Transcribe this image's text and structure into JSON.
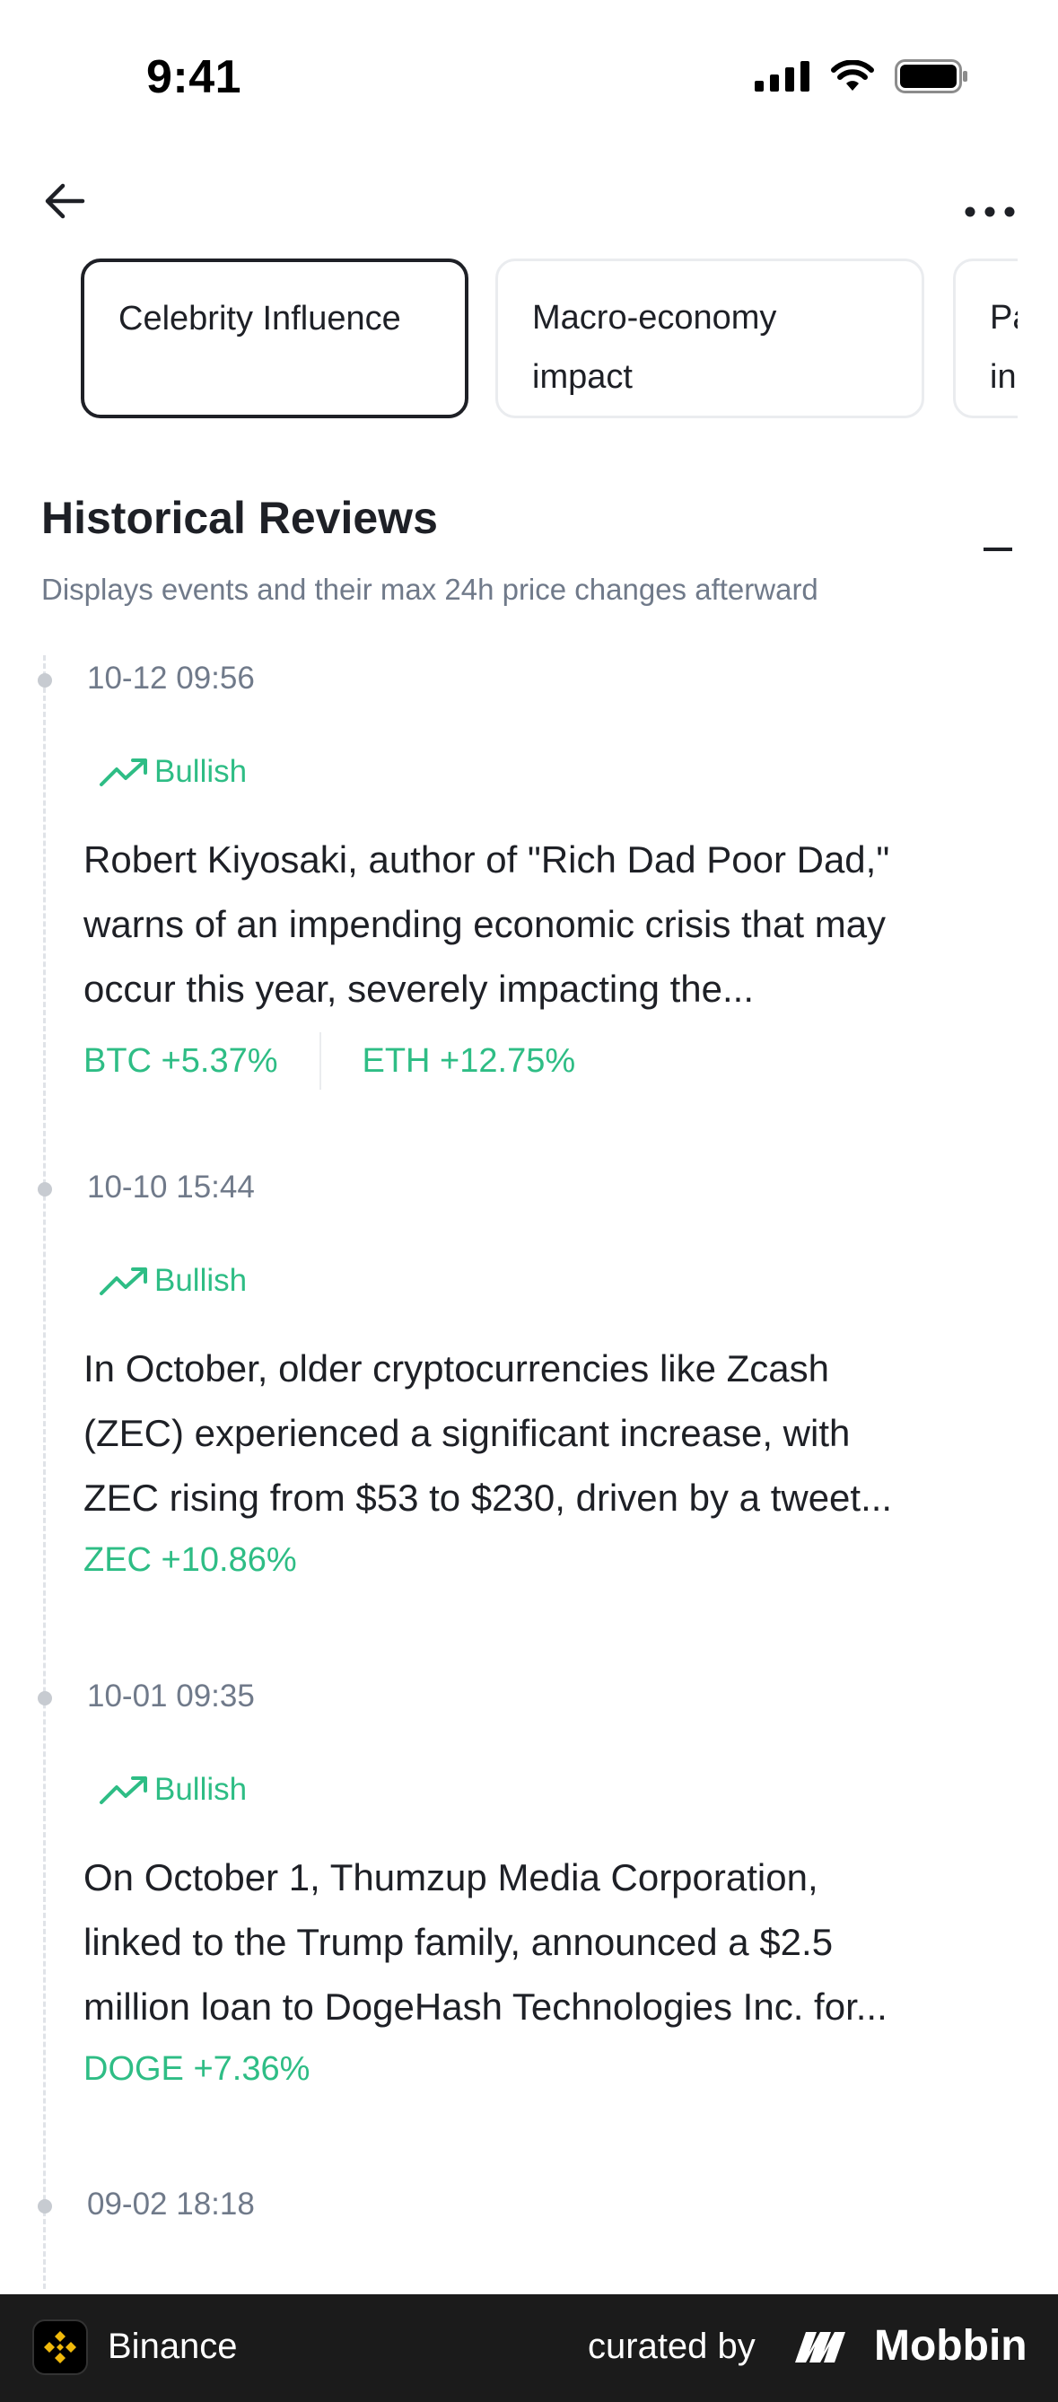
{
  "status_bar": {
    "time": "9:41"
  },
  "tabs": [
    {
      "label_line1": "Celebrity Influence",
      "label_line2": ""
    },
    {
      "label_line1": "Macro-economy",
      "label_line2": "impact"
    },
    {
      "label_line1": "Pa",
      "label_line2": "in"
    }
  ],
  "section": {
    "title": "Historical Reviews",
    "subtitle": "Displays events and their max 24h price changes afterward"
  },
  "events": [
    {
      "time": "10-12 09:56",
      "sentiment": "Bullish",
      "lines": [
        "Robert Kiyosaki, author of \"Rich Dad Poor Dad,\"",
        "warns of an impending economic crisis that may",
        "occur this year, severely impacting the..."
      ],
      "changes": [
        "BTC +5.37%",
        "ETH +12.75%"
      ]
    },
    {
      "time": "10-10 15:44",
      "sentiment": "Bullish",
      "lines": [
        "In October, older cryptocurrencies like Zcash",
        "(ZEC) experienced a significant increase, with",
        "ZEC rising from $53 to $230, driven by a tweet..."
      ],
      "changes": [
        "ZEC +10.86%"
      ]
    },
    {
      "time": "10-01 09:35",
      "sentiment": "Bullish",
      "lines": [
        "On October 1, Thumzup Media Corporation,",
        "linked to the Trump family, announced a $2.5",
        "million loan to DogeHash Technologies Inc. for..."
      ],
      "changes": [
        "DOGE +7.36%"
      ]
    },
    {
      "time": "09-02 18:18"
    }
  ],
  "footer": {
    "app_name": "Binance",
    "curated_by": "curated by",
    "brand": "Mobbin"
  },
  "colors": {
    "bullish": "#2ebd85",
    "text_primary": "#1e2026",
    "text_secondary": "#707a8a",
    "footer_bg": "#1b1b1b",
    "binance_yellow": "#f0b90b"
  }
}
